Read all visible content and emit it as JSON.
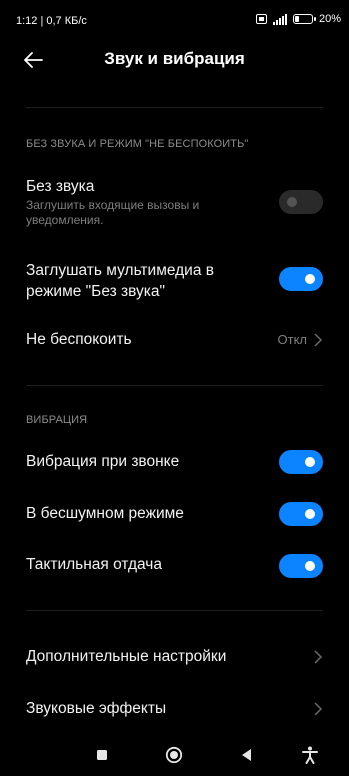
{
  "status_bar": {
    "time_speed": "1:12 | 0,7 КБ/с",
    "battery_percent": "20%"
  },
  "header": {
    "title": "Звук и вибрация",
    "back_icon": "arrow-left-icon"
  },
  "sections": {
    "silent": {
      "header": "БЕЗ ЗВУКА И РЕЖИМ \"НЕ БЕСПОКОИТЬ\"",
      "silent_mode": {
        "title": "Без звука",
        "subtitle": "Заглушить входящие вызовы и уведомления.",
        "enabled": false
      },
      "mute_media": {
        "title": "Заглушать мультимедиа в режиме \"Без звука\"",
        "enabled": true
      },
      "dnd": {
        "title": "Не беспокоить",
        "value": "Откл"
      }
    },
    "vibration": {
      "header": "ВИБРАЦИЯ",
      "on_ring": {
        "title": "Вибрация при звонке",
        "enabled": true
      },
      "on_silent": {
        "title": "В бесшумном режиме",
        "enabled": true
      },
      "haptic": {
        "title": "Тактильная отдача",
        "enabled": true
      }
    },
    "more": {
      "additional": {
        "title": "Дополнительные настройки"
      },
      "sound_effects": {
        "title": "Звуковые эффекты"
      }
    }
  },
  "colors": {
    "accent": "#0d84ff",
    "background": "#000000",
    "secondary_text": "#7f7f7f"
  },
  "nav_bar": {
    "icons": [
      "square-icon",
      "home-circle-icon",
      "back-triangle-icon",
      "accessibility-icon"
    ]
  }
}
